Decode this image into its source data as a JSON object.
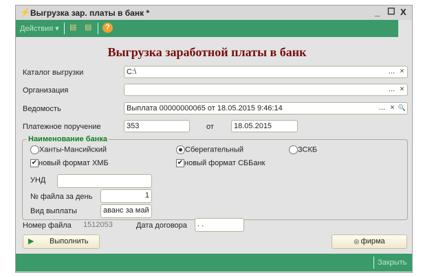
{
  "window": {
    "title": "Выгрузка зар. платы в банк *",
    "minimize": "_",
    "maximize": "☐",
    "close": "X"
  },
  "toolbar": {
    "actions": "Действия",
    "help": "?"
  },
  "heading": "Выгрузка заработной платы в банк",
  "form": {
    "catalog_label": "Каталог выгрузки",
    "catalog_value": "C:\\",
    "org_label": "Организация",
    "org_value": "",
    "statement_label": "Ведомость",
    "statement_value": "Выплата 00000000065 от 18.05.2015 9:46:14",
    "payment_label": "Платежное поручение",
    "payment_value": "353",
    "from_label": "от",
    "payment_date": "18.05.2015",
    "select_btn": "...",
    "clear_btn": "×",
    "search_btn": "🔍"
  },
  "bank": {
    "legend": "Наименование банка",
    "radios": [
      {
        "label": "Ханты-Мансийский",
        "checked": false
      },
      {
        "label": "Сберегательный",
        "checked": true
      },
      {
        "label": "ЗСКБ",
        "checked": false
      }
    ],
    "checks": [
      {
        "label": "новый формат ХМБ",
        "checked": true
      },
      {
        "label": "новый формат СББанк",
        "checked": true
      }
    ],
    "und_label": "УНД",
    "und_value": "",
    "file_no_label": "№ файла за день",
    "file_no_value": "1",
    "payment_type_label": "Вид выплаты",
    "payment_type_value": "аванс за май"
  },
  "footer": {
    "file_number_label": "Номер файла",
    "file_number_value": "1512053",
    "contract_date_label": "Дата договора",
    "contract_date_value": " . .",
    "run_button": "Выполнить",
    "firm_button": "фирма",
    "close_button": "Закрыть"
  }
}
